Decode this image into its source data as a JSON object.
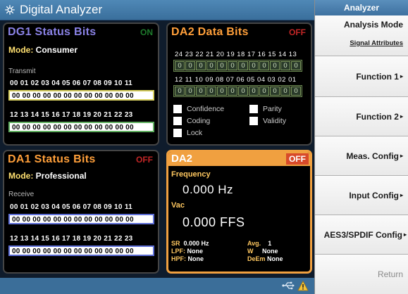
{
  "titlebar": {
    "title": "Digital Analyzer",
    "icon": "sun-icon"
  },
  "dg1": {
    "title": "DG1  Status Bits",
    "state": "ON",
    "mode_label": "Mode:",
    "mode_value": "Consumer",
    "direction": "Transmit",
    "idx1": "00 01 02 03 04 05 06 07 08 09 10 11",
    "bytes1": "00 00 00 00 00 00 00 00 00 00 00 00",
    "idx2": "12 13 14 15 16 17 18 19 20 21 22 23",
    "bytes2": "00 00 00 00 00 00 00 00 00 00 00 00"
  },
  "da2_bits": {
    "title": "DA2  Data Bits",
    "state": "OFF",
    "nums_hi": "24  23  22  21  20  19  18  17  16  15  14  13",
    "bits_hi": [
      "0",
      "0",
      "0",
      "0",
      "0",
      "0",
      "0",
      "0",
      "0",
      "0",
      "0",
      "0"
    ],
    "nums_lo": "12  11  10  09  08  07  06  05  04  03  02  01",
    "bits_lo": [
      "0",
      "0",
      "0",
      "0",
      "0",
      "0",
      "0",
      "0",
      "0",
      "0",
      "0",
      "0"
    ],
    "checks": {
      "confidence": "Confidence",
      "parity": "Parity",
      "coding": "Coding",
      "validity": "Validity",
      "lock": "Lock"
    }
  },
  "da1": {
    "title": "DA1  Status Bits",
    "state": "OFF",
    "mode_label": "Mode:",
    "mode_value": "Professional",
    "direction": "Receive",
    "idx1": "00 01 02 03 04 05 06 07 08 09 10 11",
    "bytes1": "00 00 00 00 00 00 00 00 00 00 00 00",
    "idx2": "12 13 14 15 16 17 18 19 20 21 22 23",
    "bytes2": "00 00 00 00 00 00 00 00 00 00 00 00"
  },
  "da2_meas": {
    "title": "DA2",
    "state": "OFF",
    "freq_label": "Frequency",
    "freq_value": "0.000 Hz",
    "vac_label": "Vac",
    "vac_value": "0.000 FFS",
    "sr_label": "SR",
    "sr_value": "0.000 Hz",
    "avg_label": "Avg.",
    "avg_value": "1",
    "lpf_label": "LPF:",
    "lpf_value": "None",
    "w_label": "W",
    "w_value": "None",
    "hpf_label": "HPF:",
    "hpf_value": "None",
    "deem_label": "DeEm",
    "deem_value": "None"
  },
  "softkeys": {
    "header": "Analyzer",
    "analysis_mode": "Analysis Mode",
    "analysis_mode_value": "Signal Attributes",
    "function1": "Function 1",
    "function2": "Function 2",
    "meas_config": "Meas. Config",
    "input_config": "Input Config",
    "aes3": "AES3/SPDIF Config",
    "return": "Return",
    "arrow": "▸"
  },
  "status": {
    "usb": "usb-icon",
    "warning": "warning-icon"
  },
  "colors": {
    "accent": "#f0a040",
    "titlebar": "#3f76a4",
    "on": "#1d7a2c",
    "off": "#c22626"
  }
}
